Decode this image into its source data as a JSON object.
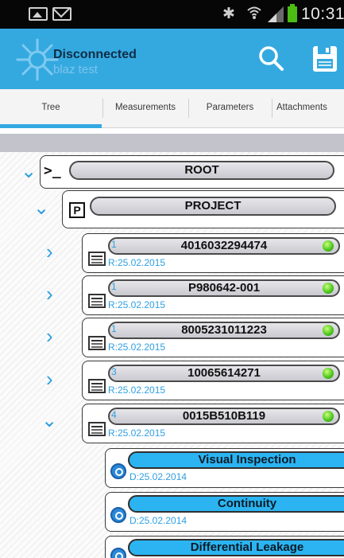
{
  "status_bar": {
    "time": "10:31",
    "icons": [
      "image-icon",
      "mail-icon",
      "bluetooth-icon",
      "wifi-icon",
      "signal-icon",
      "battery-icon"
    ]
  },
  "action_bar": {
    "status": "Disconnected",
    "subtitle": "blaz test",
    "actions": [
      "search-icon",
      "save-icon"
    ]
  },
  "tabs": [
    {
      "label": "Tree",
      "selected": true
    },
    {
      "label": "Measurements",
      "selected": false
    },
    {
      "label": "Parameters",
      "selected": false
    },
    {
      "label": "Attachments",
      "selected": false
    }
  ],
  "tree": {
    "root": {
      "label": "ROOT",
      "icon": "terminal-icon",
      "expanded": true
    },
    "project": {
      "label": "PROJECT",
      "icon": "project-p-icon",
      "expanded": true
    },
    "devices": [
      {
        "index": "1",
        "id": "4016032294474",
        "date": "R:25.02.2015",
        "expanded": false
      },
      {
        "index": "1",
        "id": "P980642-001",
        "date": "R:25.02.2015",
        "expanded": false
      },
      {
        "index": "1",
        "id": "8005231011223",
        "date": "R:25.02.2015",
        "expanded": false
      },
      {
        "index": "3",
        "id": "10065614271",
        "date": "R:25.02.2015",
        "expanded": false
      },
      {
        "index": "4",
        "id": "0015B510B119",
        "date": "R:25.02.2015",
        "expanded": true
      }
    ],
    "measurements": [
      {
        "label": "Visual Inspection",
        "date": "D:25.02.2014"
      },
      {
        "label": "Continuity",
        "date": "D:25.02.2014"
      },
      {
        "label": "Differential Leakage",
        "date": ""
      }
    ]
  },
  "colors": {
    "accent": "#34a9e0",
    "measurement_pill": "#2bb4f1",
    "status_ok": "#47c41a",
    "text_link": "#2e9fe2"
  }
}
